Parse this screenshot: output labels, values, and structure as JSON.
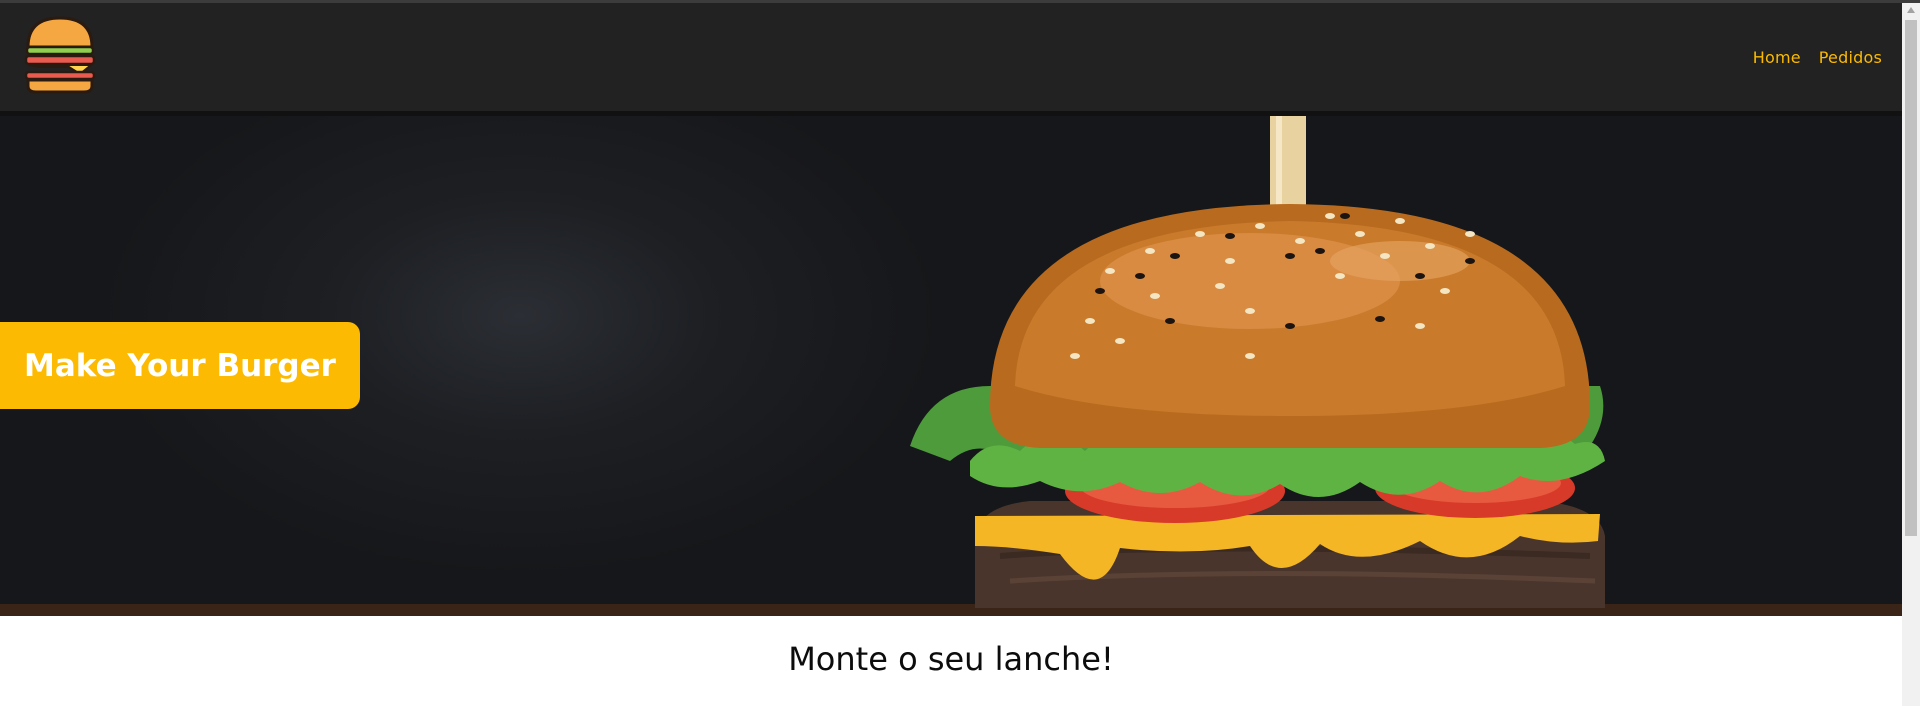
{
  "header": {
    "logo_icon": "burger-icon",
    "nav": [
      {
        "label": "Home"
      },
      {
        "label": "Pedidos"
      }
    ]
  },
  "hero": {
    "title": "Make Your Burger",
    "image": "burger-photo"
  },
  "main": {
    "heading": "Monte o seu lanche!"
  },
  "colors": {
    "accent": "#fcba03",
    "navbar": "#222222",
    "hero_bg": "#1d1f23",
    "heading_text": "#0c0c0c"
  }
}
